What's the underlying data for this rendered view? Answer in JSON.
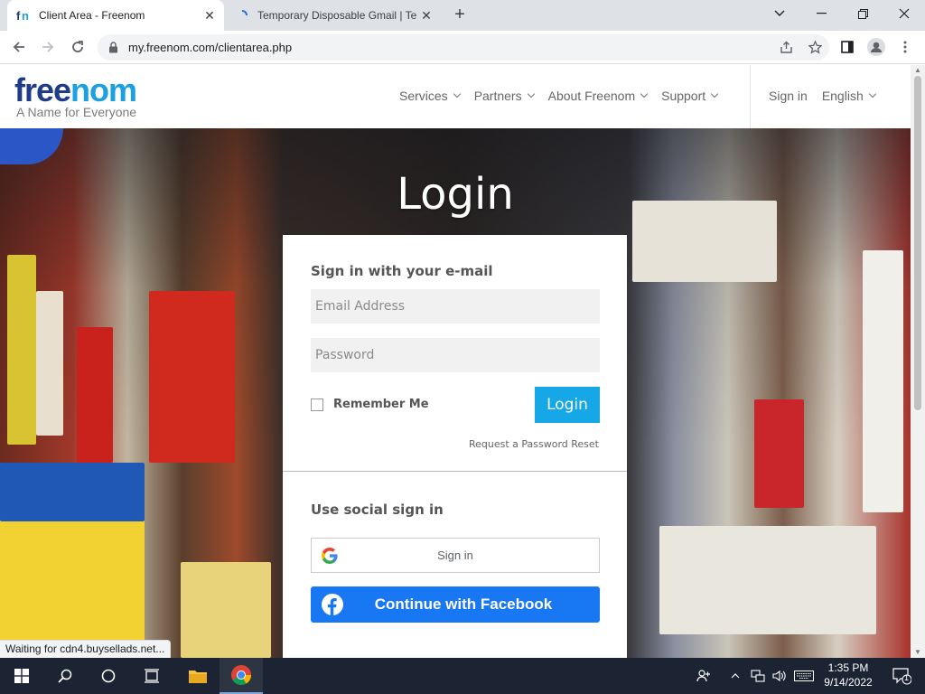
{
  "browser": {
    "tabs": [
      {
        "title": "Client Area - Freenom",
        "active": true
      },
      {
        "title": "Temporary Disposable Gmail | Te",
        "active": false
      }
    ],
    "url": "my.freenom.com/clientarea.php",
    "status_text": "Waiting for cdn4.buysellads.net..."
  },
  "site": {
    "logo_text": "freenom",
    "tagline": "A Name for Everyone",
    "nav": [
      "Services",
      "Partners",
      "About Freenom",
      "Support"
    ],
    "signin_label": "Sign in",
    "language": "English"
  },
  "hero": {
    "title": "Login"
  },
  "login": {
    "heading": "Sign in with your e-mail",
    "email_placeholder": "Email Address",
    "password_placeholder": "Password",
    "remember_label": "Remember Me",
    "submit_label": "Login",
    "reset_link": "Request a Password Reset",
    "social_heading": "Use social sign in",
    "google_label": "Sign in",
    "facebook_label": "Continue with Facebook"
  },
  "taskbar": {
    "time": "1:35 PM",
    "date": "9/14/2022",
    "notification_count": "1"
  },
  "colors": {
    "freenom_dark_blue": "#1f3c88",
    "freenom_light_blue": "#1ba0e2",
    "login_button": "#15a7e6",
    "facebook_blue": "#1877f2",
    "taskbar": "#1c2433"
  }
}
